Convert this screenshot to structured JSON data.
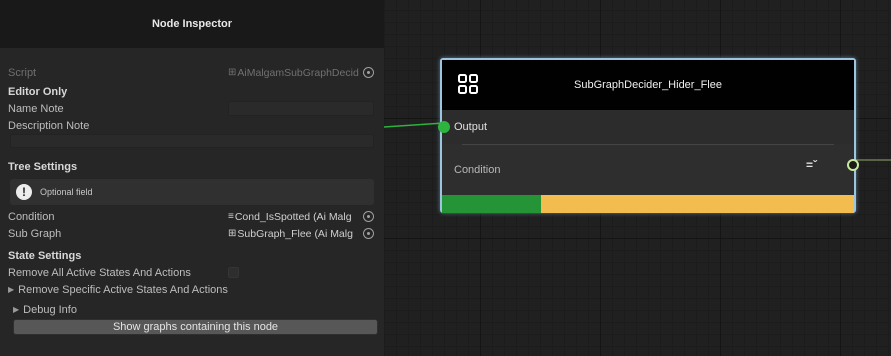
{
  "inspector": {
    "title": "Node Inspector",
    "script_label": "Script",
    "script_value": "AiMalgamSubGraphDecid",
    "script_icon": "grid-icon",
    "editor_only": {
      "heading": "Editor Only",
      "name_note_label": "Name Note",
      "name_note_value": "",
      "description_note_label": "Description Note",
      "description_note_value": ""
    },
    "tree_settings": {
      "heading": "Tree Settings",
      "help_text": "Optional field",
      "condition_label": "Condition",
      "condition_value": "Cond_IsSpotted (Ai Malg",
      "condition_icon": "condition-icon",
      "sub_graph_label": "Sub Graph",
      "sub_graph_value": "SubGraph_Flee (Ai Malg",
      "sub_graph_icon": "grid-icon"
    },
    "state_settings": {
      "heading": "State Settings",
      "remove_all_label": "Remove All Active States And Actions",
      "remove_all_checked": false,
      "remove_specific_label": "Remove Specific Active States And Actions"
    },
    "debug_info_label": "Debug Info",
    "show_graphs_button": "Show graphs containing this node"
  },
  "node": {
    "title": "SubGraphDecider_Hider_Flee",
    "output_label": "Output",
    "condition_label": "Condition",
    "progress": 0.24,
    "colors": {
      "border": "#9cc6e0",
      "port_output": "#2db33e",
      "progress_fill": "#259437",
      "progress_track": "#f2bc4e"
    }
  }
}
